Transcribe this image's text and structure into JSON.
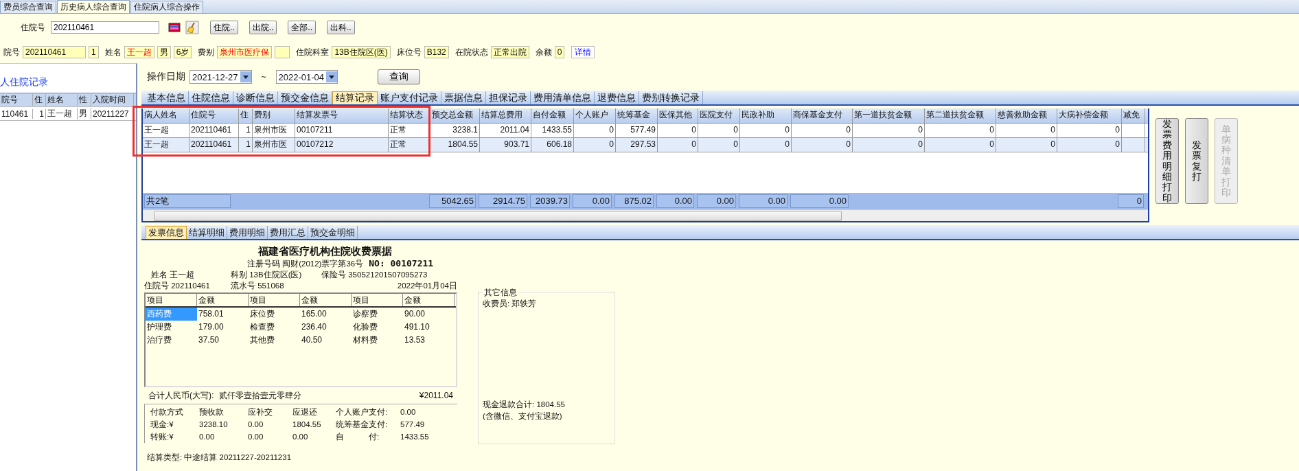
{
  "top_tabs": [
    {
      "label": "费员综合查询",
      "selected": false
    },
    {
      "label": "历史病人综合查询",
      "selected": true
    },
    {
      "label": "住院病人综合操作",
      "selected": false
    }
  ],
  "search": {
    "label": "住院号",
    "value": "202110461",
    "buttons": [
      "住院..",
      "出院..",
      "全部..",
      "出科.."
    ]
  },
  "patient_fields": [
    {
      "kind": "label",
      "text": "院号"
    },
    {
      "kind": "field",
      "text": "202110461",
      "alert": false
    },
    {
      "kind": "field",
      "text": "1",
      "alert": false
    },
    {
      "kind": "label",
      "text": "姓名"
    },
    {
      "kind": "field",
      "text": "王一超",
      "alert": true
    },
    {
      "kind": "field",
      "text": "男",
      "alert": false
    },
    {
      "kind": "field",
      "text": "6岁",
      "alert": false
    },
    {
      "kind": "label",
      "text": "费别"
    },
    {
      "kind": "field",
      "text": "泉州市医疗保",
      "alert": true
    },
    {
      "kind": "blank"
    },
    {
      "kind": "label",
      "text": "住院科室"
    },
    {
      "kind": "field",
      "text": "13B住院区(医)",
      "alert": false
    },
    {
      "kind": "label",
      "text": "床位号"
    },
    {
      "kind": "field",
      "text": "B132",
      "alert": false
    },
    {
      "kind": "label",
      "text": "在院状态"
    },
    {
      "kind": "field",
      "text": "正常出院",
      "alert": false
    },
    {
      "kind": "label",
      "text": "余额"
    },
    {
      "kind": "field",
      "text": "0",
      "alert": false
    },
    {
      "kind": "link",
      "text": "详情"
    }
  ],
  "history": {
    "title": "人住院记录",
    "columns": [
      "院号",
      "住",
      "姓名",
      "性",
      "入院时间"
    ],
    "rows": [
      [
        "110461",
        "1",
        "王一超",
        "男",
        "20211227"
      ]
    ]
  },
  "date_filter": {
    "label": "操作日期",
    "from": "2021-12-27",
    "separator": "~",
    "to": "2022-01-04",
    "button": "查询"
  },
  "detail_tabs": [
    {
      "label": "基本信息",
      "selected": false
    },
    {
      "label": "住院信息",
      "selected": false
    },
    {
      "label": "诊断信息",
      "selected": false
    },
    {
      "label": "预交金信息",
      "selected": false
    },
    {
      "label": "结算记录",
      "selected": true
    },
    {
      "label": "账户支付记录",
      "selected": false
    },
    {
      "label": "票据信息",
      "selected": false
    },
    {
      "label": "担保记录",
      "selected": false
    },
    {
      "label": "费用清单信息",
      "selected": false
    },
    {
      "label": "退费信息",
      "selected": false
    },
    {
      "label": "费别转换记录",
      "selected": false
    }
  ],
  "settlement_table": {
    "columns": [
      "病人姓名",
      "住院号",
      "住",
      "费别",
      "结算发票号",
      "结算状态",
      "预交总金额",
      "结算总费用",
      "自付金额",
      "个人账户",
      "统筹基金",
      "医保其他",
      "医院支付",
      "民政补助",
      "商保基金支付",
      "第一道扶贫金额",
      "第二道扶贫金额",
      "慈善救助金额",
      "大病补偿金额",
      "减免"
    ],
    "rows": [
      [
        "王一超",
        "202110461",
        "1",
        "泉州市医",
        "00107211",
        "正常",
        "3238.1",
        "2011.04",
        "1433.55",
        "0",
        "577.49",
        "0",
        "0",
        "0",
        "0",
        "0",
        "0",
        "0",
        "0"
      ],
      [
        "王一超",
        "202110461",
        "1",
        "泉州市医",
        "00107212",
        "正常",
        "1804.55",
        "903.71",
        "606.18",
        "0",
        "297.53",
        "0",
        "0",
        "0",
        "0",
        "0",
        "0",
        "0",
        "0"
      ]
    ],
    "footer": {
      "count": "共2笔",
      "sums": [
        "5042.65",
        "2914.75",
        "2039.73",
        "0.00",
        "875.02",
        "0.00",
        "0.00",
        "0.00",
        "0.00"
      ],
      "last_column_sum": "0"
    }
  },
  "side_buttons": [
    {
      "label": "发票费用明细打印",
      "disabled": false
    },
    {
      "label": "发票复打",
      "disabled": false
    },
    {
      "label": "单病种清单打印",
      "disabled": true
    }
  ],
  "bottom_tabs": [
    {
      "label": "发票信息",
      "selected": true
    },
    {
      "label": "结算明细",
      "selected": false
    },
    {
      "label": "费用明细",
      "selected": false
    },
    {
      "label": "费用汇总",
      "selected": false
    },
    {
      "label": "预交金明细",
      "selected": false
    }
  ],
  "invoice": {
    "title": "福建省医疗机构住院收费票据",
    "registration": "注册号码 闽财(2012)票字第36号",
    "number": "NO: 00107211",
    "name": "姓名 王一超",
    "department": "科别 13B住院区(医)",
    "insurance": "保险号 350521201507095273",
    "admission": "住院号 202110461",
    "serial": "流水号 551068",
    "date": "2022年01月04日",
    "item_headers": [
      "项目",
      "金额",
      "项目",
      "金额",
      "项目",
      "金额"
    ],
    "items": [
      [
        {
          "name": "西药费",
          "amount": "758.01",
          "selected": true
        },
        {
          "name": "床位费",
          "amount": "165.00",
          "selected": false
        },
        {
          "name": "诊察费",
          "amount": "90.00",
          "selected": false
        }
      ],
      [
        {
          "name": "护理费",
          "amount": "179.00",
          "selected": false
        },
        {
          "name": "检查费",
          "amount": "236.40",
          "selected": false
        },
        {
          "name": "化验费",
          "amount": "491.10",
          "selected": false
        }
      ],
      [
        {
          "name": "治疗费",
          "amount": "37.50",
          "selected": false
        },
        {
          "name": "其他费",
          "amount": "40.50",
          "selected": false
        },
        {
          "name": "材料费",
          "amount": "13.53",
          "selected": false
        }
      ]
    ],
    "total_label": "合计人民币(大写):",
    "total_words": "贰仟零壹拾壹元零肆分",
    "total_amount": "¥2011.04",
    "payment": [
      [
        "付款方式",
        "预收款",
        "应补交",
        "应退还",
        "个人账户支付:",
        "0.00"
      ],
      [
        "现金:¥",
        "3238.10",
        "0.00",
        "1804.55",
        "统筹基金支付:",
        "577.49"
      ],
      [
        "转账:¥",
        "0.00",
        "0.00",
        "0.00",
        "自　　　付:",
        "1433.55"
      ]
    ],
    "settlement_type": "结算类型: 中途结算 20211227-20211231"
  },
  "other_info": {
    "title": "其它信息",
    "cashier": "收费员: 郑轶芳",
    "refund_total": "现金退款合计: 1804.55",
    "refund_note": "(含微信、支付宝退款)"
  }
}
